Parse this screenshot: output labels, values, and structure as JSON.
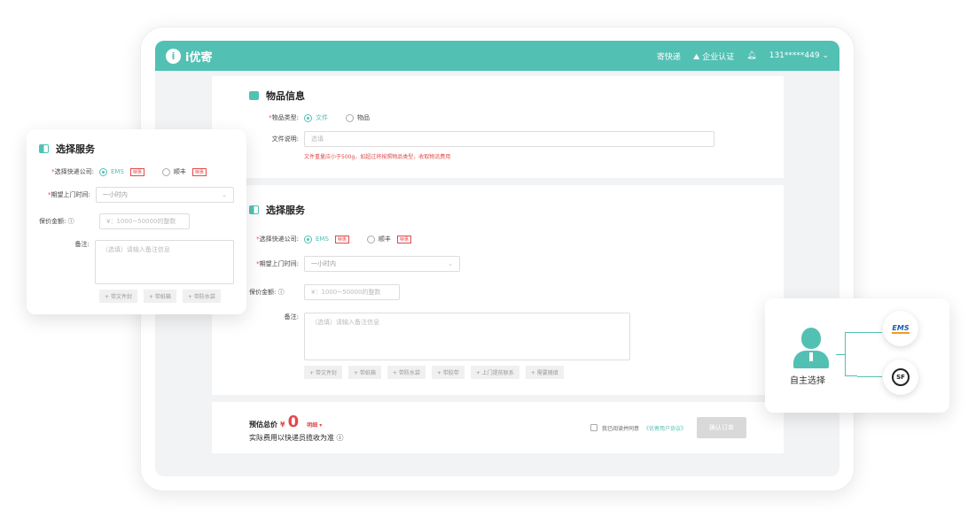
{
  "app": {
    "logo_glyph": "i",
    "name": "i优寄"
  },
  "topnav": {
    "send": "寄快递",
    "cert": "企业认证",
    "bell": "",
    "phone": "131*****449",
    "chevron": "⌄"
  },
  "item_section": {
    "title": "物品信息",
    "type_label": "物品类型:",
    "required_mark": "*",
    "type_options": [
      "文件",
      "物品"
    ],
    "type_selected": "文件",
    "desc_label": "文件说明:",
    "desc_placeholder": "选填",
    "warning": "文件重量应小于500g，如超过将按照物品类型，收取物流费用"
  },
  "service_section": {
    "title": "选择服务",
    "courier_label": "选择快递公司:",
    "couriers": [
      {
        "name": "EMS",
        "tag": "特惠"
      },
      {
        "name": "顺丰",
        "tag": "特惠"
      }
    ],
    "courier_selected": "EMS",
    "time_label": "期望上门时间:",
    "time_value": "一小时内",
    "insure_label": "保价金额:",
    "insure_placeholder": "¥：1000~50000的整数",
    "remark_label": "备注:",
    "remark_placeholder": "（选填）请输入备注信息",
    "chips": [
      "带文件封",
      "带纸箱",
      "带防水袋",
      "带胶带",
      "上门提前联系",
      "需要随填"
    ]
  },
  "footer": {
    "est_label": "预估总价",
    "yen": "¥",
    "price": "0",
    "detail": "明细",
    "note": "实际费用以快递员揽收为准",
    "agree_text": "我已阅读并同意",
    "agree_link": "《优寄用户协议》",
    "confirm": "确认订单"
  },
  "float_card": {
    "title": "选择服务",
    "courier_label": "选择快递公司:",
    "time_label": "期望上门时间:",
    "time_value": "一小时内",
    "insure_label": "保价金额:",
    "insure_placeholder": "¥：1000~50000的整数",
    "remark_label": "备注:",
    "remark_placeholder": "（选填）请输入备注信息",
    "chips": [
      "带文件封",
      "带纸箱",
      "带防水袋"
    ]
  },
  "right_card": {
    "label": "自主选择",
    "logos": [
      "EMS",
      "SF"
    ]
  },
  "colors": {
    "accent": "#53c0b4",
    "danger": "#e24a4a"
  }
}
